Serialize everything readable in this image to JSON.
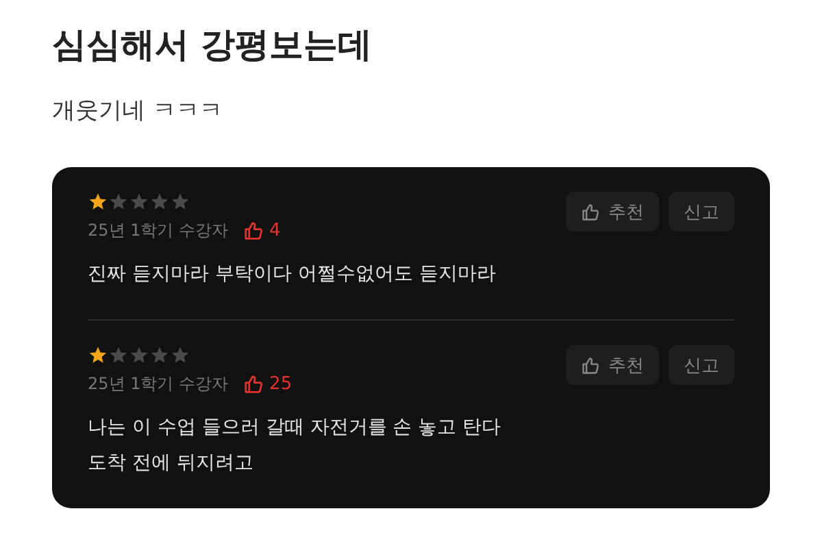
{
  "post": {
    "title": "심심해서 강평보는데",
    "body": "개웃기네 ㅋㅋㅋ"
  },
  "reviews": [
    {
      "stars": 1,
      "meta": "25년 1학기 수강자",
      "likes": "4",
      "recommend": "추천",
      "report": "신고",
      "lines": [
        "진짜 듣지마라 부탁이다 어쩔수없어도 듣지마라"
      ]
    },
    {
      "stars": 1,
      "meta": "25년 1학기 수강자",
      "likes": "25",
      "recommend": "추천",
      "report": "신고",
      "lines": [
        "나는 이 수업 들으러 갈때 자전거를 손 놓고 탄다",
        "도착 전에 뒤지려고"
      ]
    }
  ]
}
